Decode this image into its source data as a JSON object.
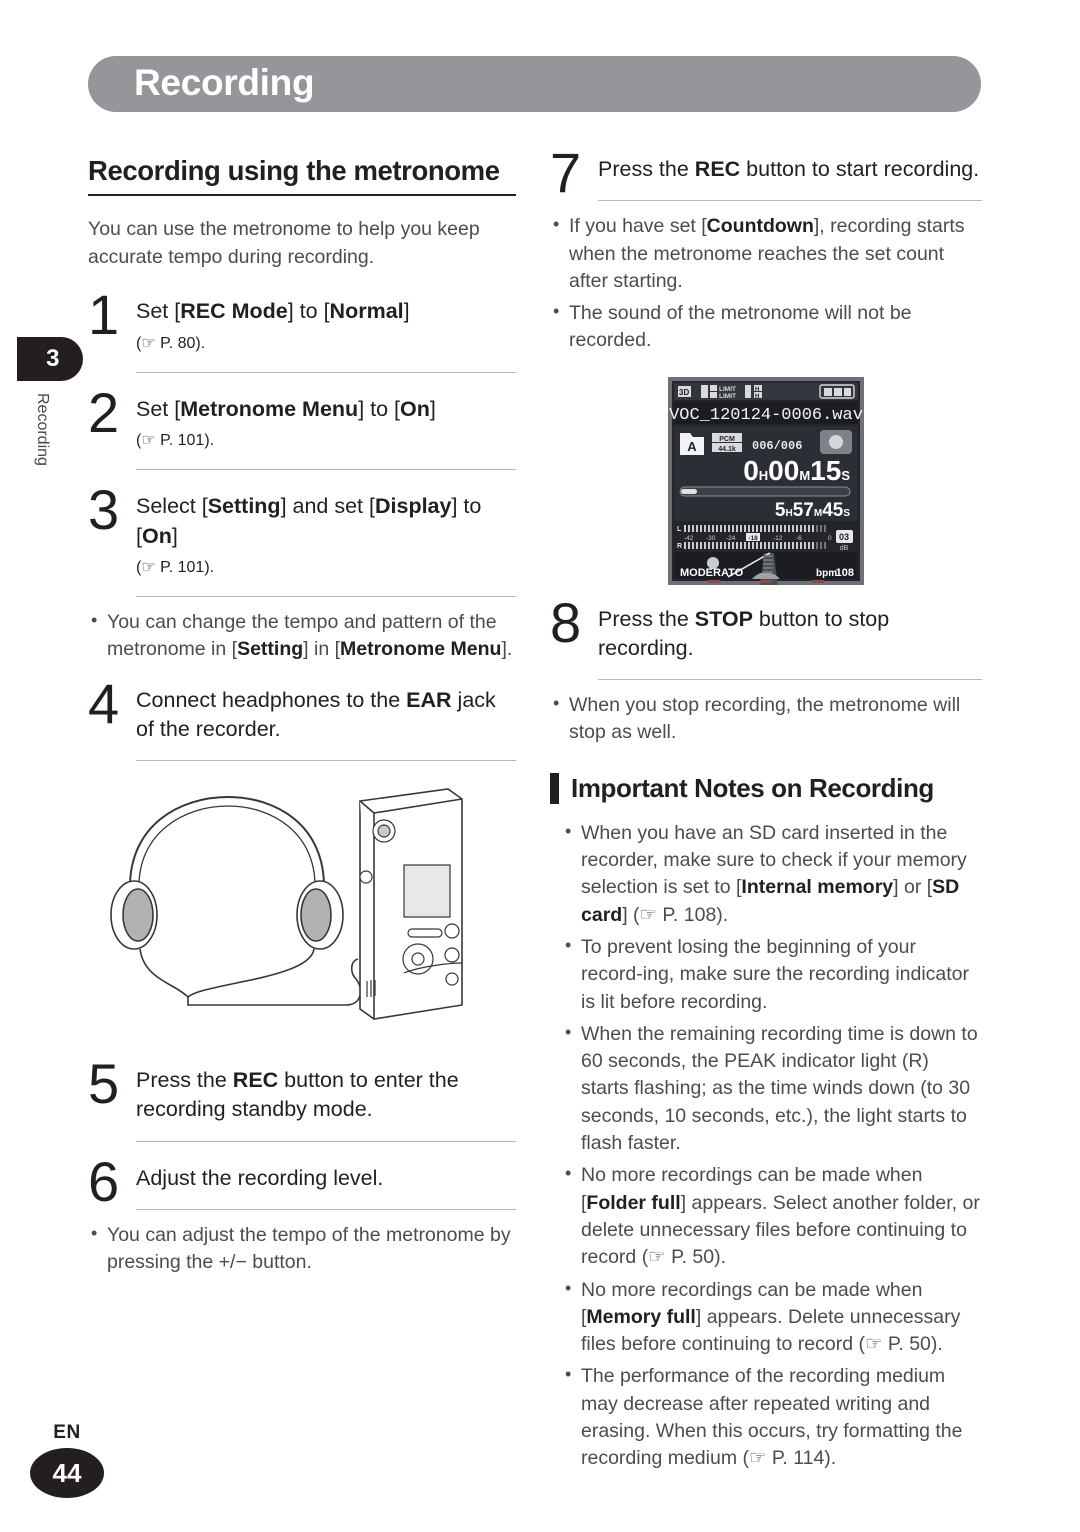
{
  "header": {
    "title": "Recording"
  },
  "sidebar": {
    "chapter_number": "3",
    "chapter_label": "Recording"
  },
  "footer": {
    "language": "EN",
    "page_number": "44"
  },
  "left_column": {
    "section_title": "Recording using the metronome",
    "intro": "You can use the metronome to help you keep accurate tempo during recording.",
    "steps": [
      {
        "number": "1",
        "text_parts": [
          {
            "t": "Set [",
            "b": false
          },
          {
            "t": "REC Mode",
            "b": true
          },
          {
            "t": "] to [",
            "b": false
          },
          {
            "t": "Normal",
            "b": true
          },
          {
            "t": "] ",
            "b": false
          }
        ],
        "reference": "(☞ P. 80)."
      },
      {
        "number": "2",
        "text_parts": [
          {
            "t": "Set [",
            "b": false
          },
          {
            "t": "Metronome Menu",
            "b": true
          },
          {
            "t": "] to [",
            "b": false
          },
          {
            "t": "On",
            "b": true
          },
          {
            "t": "] ",
            "b": false
          }
        ],
        "reference": "(☞ P. 101)."
      },
      {
        "number": "3",
        "text_parts": [
          {
            "t": "Select [",
            "b": false
          },
          {
            "t": "Setting",
            "b": true
          },
          {
            "t": "] and set [",
            "b": false
          },
          {
            "t": "Display",
            "b": true
          },
          {
            "t": "] to [",
            "b": false
          },
          {
            "t": "On",
            "b": true
          },
          {
            "t": "] ",
            "b": false
          }
        ],
        "reference": "(☞ P. 101)."
      },
      {
        "number": "4",
        "text_parts": [
          {
            "t": "Connect headphones to the ",
            "b": false
          },
          {
            "t": "EAR",
            "b": true
          },
          {
            "t": " jack of the recorder.",
            "b": false
          }
        ],
        "reference": ""
      },
      {
        "number": "5",
        "text_parts": [
          {
            "t": "Press the ",
            "b": false
          },
          {
            "t": "REC",
            "b": true
          },
          {
            "t": " button to enter the recording standby mode.",
            "b": false
          }
        ],
        "reference": ""
      },
      {
        "number": "6",
        "text_parts": [
          {
            "t": "Adjust the recording level.",
            "b": false
          }
        ],
        "reference": ""
      }
    ],
    "note_step3": [
      {
        "t": "You can change the tempo and pattern of the metronome in [",
        "b": false
      },
      {
        "t": "Setting",
        "b": true
      },
      {
        "t": "] in [",
        "b": false
      },
      {
        "t": "Metronome Menu",
        "b": true
      },
      {
        "t": "].",
        "b": false
      }
    ],
    "note_step6": [
      {
        "t": "You can adjust the tempo of the metronome by pressing the +/− button.",
        "b": false
      }
    ],
    "illustration_label": "headphones-connected-to-recorder"
  },
  "right_column": {
    "steps": [
      {
        "number": "7",
        "text_parts": [
          {
            "t": "Press the ",
            "b": false
          },
          {
            "t": "REC",
            "b": true
          },
          {
            "t": " button to start recording.",
            "b": false
          }
        ]
      },
      {
        "number": "8",
        "text_parts": [
          {
            "t": "Press the ",
            "b": false
          },
          {
            "t": "STOP",
            "b": true
          },
          {
            "t": " button to stop recording.",
            "b": false
          }
        ]
      }
    ],
    "notes_step7": [
      [
        {
          "t": "If you have set [",
          "b": false
        },
        {
          "t": "Countdown",
          "b": true
        },
        {
          "t": "], recording starts when the metronome reaches the set count after starting.",
          "b": false
        }
      ],
      [
        {
          "t": "The sound of the metronome will not be recorded.",
          "b": false
        }
      ]
    ],
    "notes_step8": [
      [
        {
          "t": "When you stop recording, the metronome will stop as well.",
          "b": false
        }
      ]
    ],
    "important_notes_title": "Important Notes on Recording",
    "important_notes": [
      [
        {
          "t": "When you have an SD card inserted in the recorder, make sure to check if your memory selection is set to [",
          "b": false
        },
        {
          "t": "Internal memory",
          "b": true
        },
        {
          "t": "] or [",
          "b": false
        },
        {
          "t": "SD card",
          "b": true
        },
        {
          "t": "] (☞ P. 108).",
          "b": false
        }
      ],
      [
        {
          "t": "To prevent losing the beginning of your record-ing, make sure the recording indicator is lit before recording.",
          "b": false
        }
      ],
      [
        {
          "t": "When the remaining recording time is down to 60 seconds, the PEAK indicator light (R) starts flashing; as the time winds down (to 30 seconds, 10 seconds, etc.), the light starts to flash faster.",
          "b": false
        }
      ],
      [
        {
          "t": "No more recordings can be made when [",
          "b": false
        },
        {
          "t": "Folder full",
          "b": true
        },
        {
          "t": "] appears. Select another folder, or delete unnecessary files before continuing to record (☞ P. 50).",
          "b": false
        }
      ],
      [
        {
          "t": "No more recordings can be made when [",
          "b": false
        },
        {
          "t": "Memory full",
          "b": true
        },
        {
          "t": "] appears. Delete unnecessary files before continuing to record (☞ P. 50).",
          "b": false
        }
      ],
      [
        {
          "t": "The performance of the recording medium may decrease after repeated writing and erasing. When this occurs, try formatting the recording medium (☞ P. 114).",
          "b": false
        }
      ]
    ]
  },
  "lcd_screen": {
    "status_icons": [
      "3D",
      "LIMIT",
      "LIMIT",
      "H",
      "H",
      "battery"
    ],
    "filename": "VOC_120124-0006.wav",
    "folder": "A",
    "format": "PCM",
    "rate": "44.1k",
    "file_index": "006/006",
    "elapsed_hours": "0",
    "elapsed_h_unit": "H",
    "elapsed_minutes": "00",
    "elapsed_m_unit": "M",
    "elapsed_seconds": "15",
    "elapsed_s_unit": "S",
    "remaining_hours": "5",
    "remaining_h_unit": "H",
    "remaining_minutes": "57",
    "remaining_m_unit": "M",
    "remaining_seconds": "45",
    "remaining_s_unit": "S",
    "meter_left_label": "L",
    "meter_right_label": "R",
    "meter_scale": [
      "-42",
      "-30",
      "-24",
      "-18",
      "-12",
      "-6",
      "0"
    ],
    "meter_unit": "dB",
    "rec_level": "03",
    "metronome_tempo_name": "MODERATO",
    "metronome_bpm_label": "bpm",
    "metronome_bpm_value": "108"
  },
  "colors": {
    "header_bar": "#949699",
    "ink": "#231f20",
    "body_text": "#4f4b4c",
    "rule": "#b9b6b7"
  }
}
